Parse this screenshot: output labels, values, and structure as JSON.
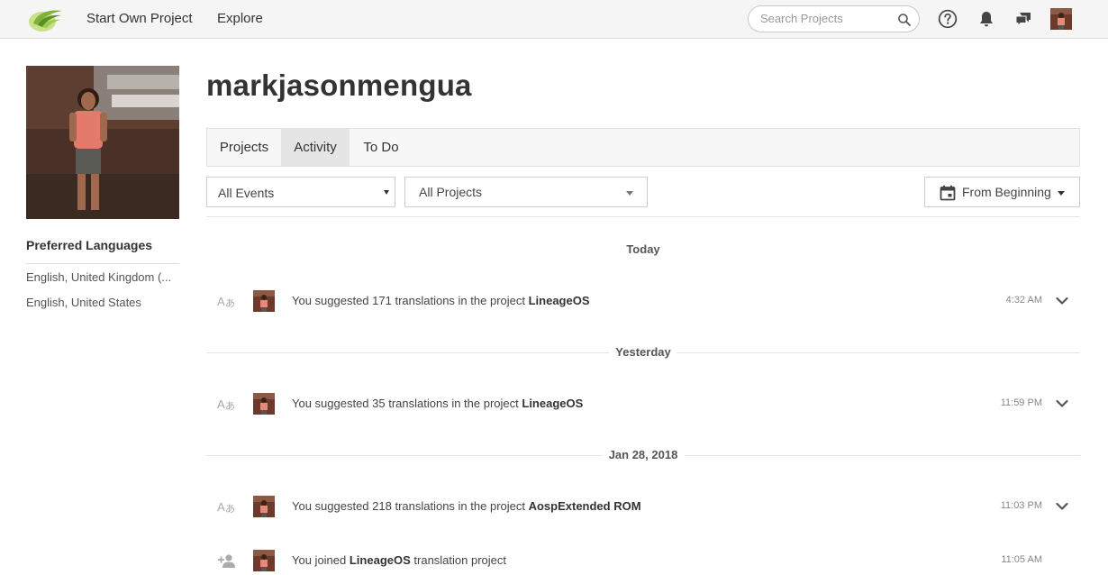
{
  "header": {
    "nav": {
      "start_project": "Start Own Project",
      "explore": "Explore"
    },
    "search": {
      "placeholder": "Search Projects",
      "value": ""
    },
    "icons": [
      "search-icon",
      "help-icon",
      "bell-icon",
      "chat-icon",
      "avatar"
    ]
  },
  "profile": {
    "username": "markjasonmengua",
    "preferred_languages_title": "Preferred Languages",
    "languages": [
      "English, United Kingdom (...",
      "English, United States"
    ]
  },
  "tabs": [
    {
      "label": "Projects",
      "active": false
    },
    {
      "label": "Activity",
      "active": true
    },
    {
      "label": "To Do",
      "active": false
    }
  ],
  "filters": {
    "events": "All Events",
    "projects": "All Projects",
    "date_range": "From Beginning"
  },
  "activity": {
    "groups": [
      {
        "date": "Today",
        "items": [
          {
            "icon": "translate-icon",
            "prefix": "You suggested 171 translations in the project ",
            "project": "LineageOS",
            "suffix": "",
            "time": "4:32 AM"
          }
        ]
      },
      {
        "date": "Yesterday",
        "items": [
          {
            "icon": "translate-icon",
            "prefix": "You suggested 35 translations in the project ",
            "project": "LineageOS",
            "suffix": "",
            "time": "11:59 PM"
          }
        ]
      },
      {
        "date": "Jan 28, 2018",
        "items": [
          {
            "icon": "translate-icon",
            "prefix": "You suggested 218 translations in the project ",
            "project": "AospExtended ROM",
            "suffix": "",
            "time": "11:03 PM"
          },
          {
            "icon": "add-person-icon",
            "prefix": "You joined ",
            "project": "LineageOS",
            "suffix": " translation project",
            "time": "11:05 AM"
          }
        ]
      }
    ]
  },
  "colors": {
    "topbar_bg": "#f5f5f5",
    "logo_green": "#8cc63f",
    "active_tab_bg": "#e5e5e5",
    "text": "#333333"
  }
}
